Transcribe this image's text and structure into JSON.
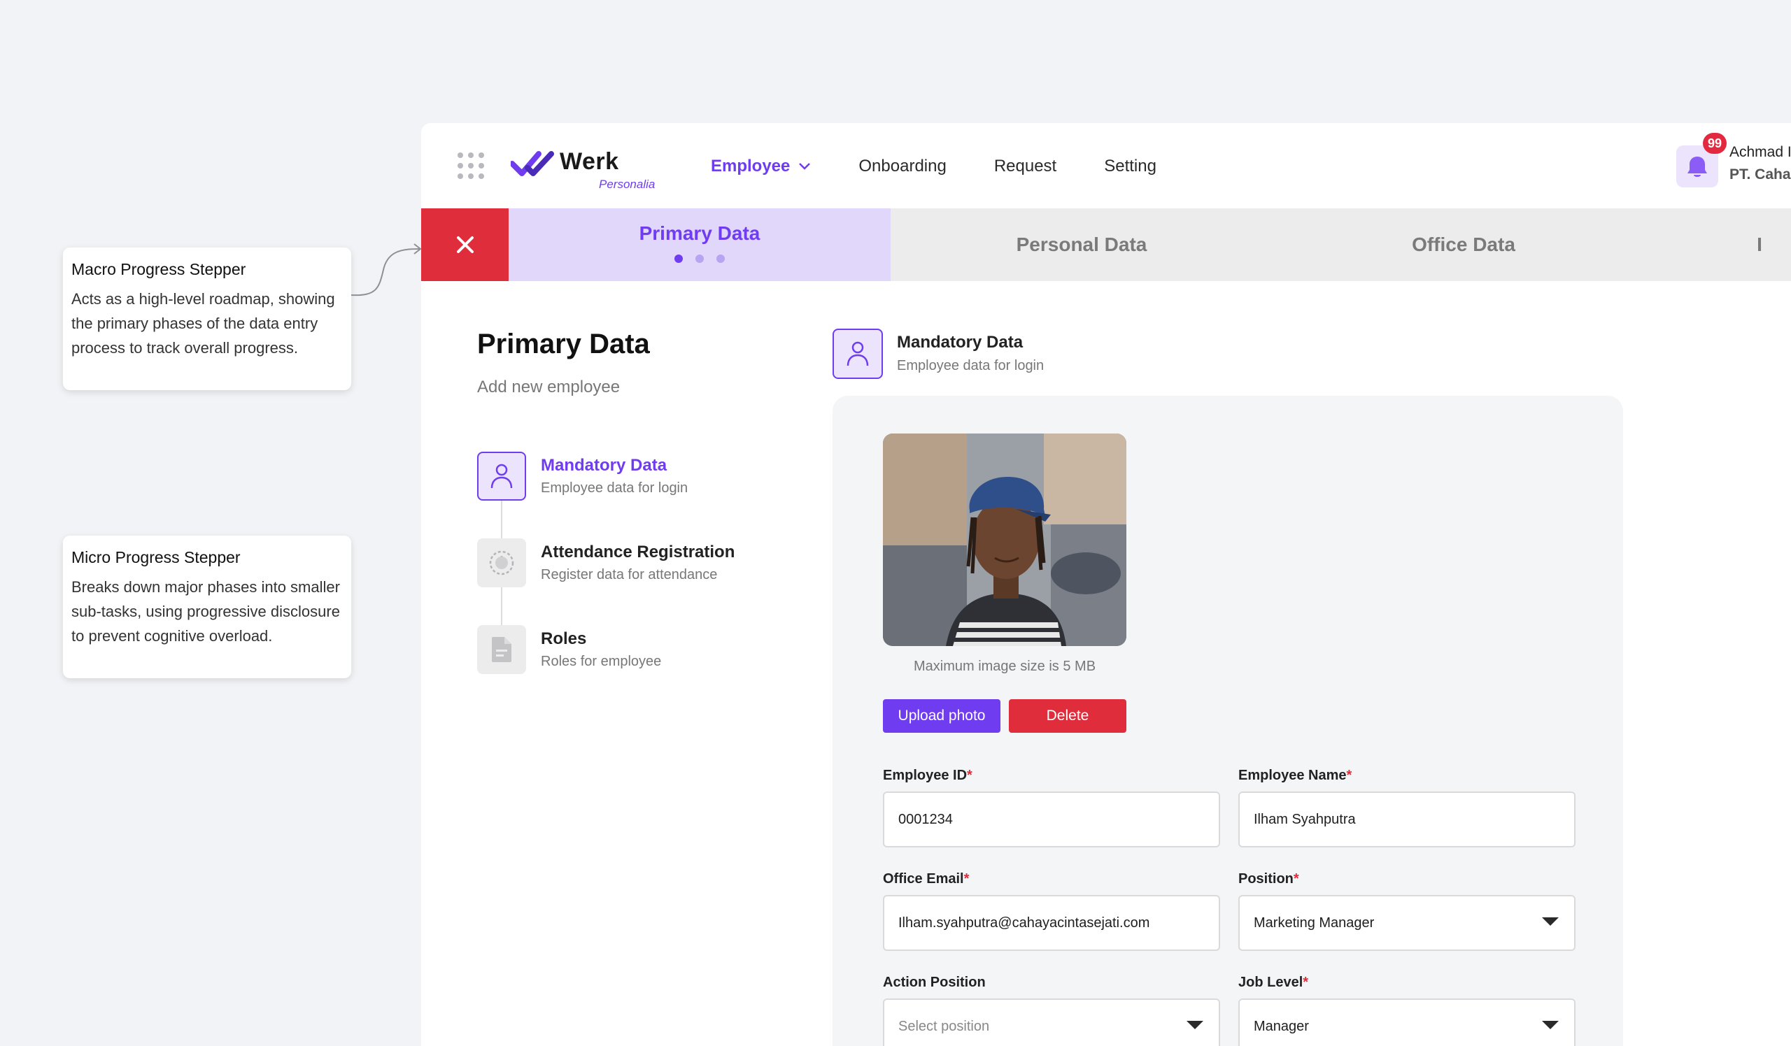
{
  "annotations": {
    "macro": {
      "title": "Macro Progress Stepper",
      "text": "Acts as a high-level roadmap, showing the primary phases of the data entry process to track overall progress."
    },
    "micro": {
      "title": "Micro Progress Stepper",
      "text": "Breaks down major phases into smaller sub-tasks, using progressive disclosure to prevent cognitive overload."
    }
  },
  "brand": {
    "name": "Werk",
    "sub": "Personalia",
    "accent": "#6f3cf0",
    "danger": "#e02d3c"
  },
  "nav": {
    "items": [
      {
        "label": "Employee",
        "active": true
      },
      {
        "label": "Onboarding"
      },
      {
        "label": "Request"
      },
      {
        "label": "Setting"
      }
    ]
  },
  "user": {
    "notifications": "99",
    "name": "Achmad I",
    "company": "PT. Caha"
  },
  "macro_steps": {
    "steps": [
      {
        "label": "Primary Data",
        "active": true
      },
      {
        "label": "Personal Data"
      },
      {
        "label": "Office Data"
      },
      {
        "label": "I"
      }
    ],
    "sub_steps_total": 3,
    "sub_step_current": 1
  },
  "page": {
    "title": "Primary Data",
    "subtitle": "Add new employee"
  },
  "micro_steps": [
    {
      "label": "Mandatory Data",
      "desc": "Employee data for login",
      "icon": "user-icon",
      "active": true
    },
    {
      "label": "Attendance Registration",
      "desc": "Register data for attendance",
      "icon": "clock-icon"
    },
    {
      "label": "Roles",
      "desc": "Roles for employee",
      "icon": "document-icon"
    }
  ],
  "section": {
    "title": "Mandatory Data",
    "subtitle": "Employee data for login"
  },
  "photo": {
    "note": "Maximum image size is 5 MB",
    "upload_label": "Upload photo",
    "delete_label": "Delete"
  },
  "form": {
    "employee_id": {
      "label": "Employee ID",
      "required": "*",
      "value": "0001234"
    },
    "employee_name": {
      "label": "Employee Name",
      "required": "*",
      "value": "Ilham Syahputra"
    },
    "office_email": {
      "label": "Office Email",
      "required": "*",
      "value": "Ilham.syahputra@cahayacintasejati.com"
    },
    "position": {
      "label": "Position",
      "required": "*",
      "value": "Marketing Manager"
    },
    "action_position": {
      "label": "Action Position",
      "placeholder": "Select position"
    },
    "job_level": {
      "label": "Job Level",
      "required": "*",
      "value": "Manager"
    }
  }
}
